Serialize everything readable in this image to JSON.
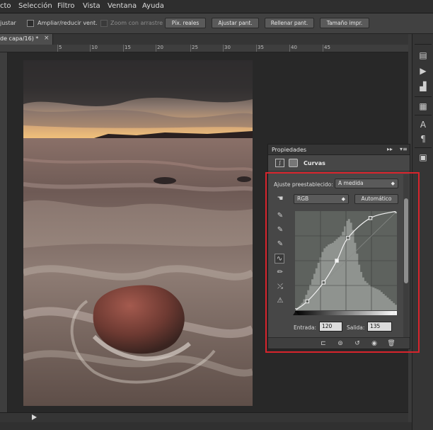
{
  "menubar": {
    "items": [
      "cto",
      "Selección",
      "Filtro",
      "Vista",
      "Ventana",
      "Ayuda"
    ]
  },
  "options_bar": {
    "left_text": "justar",
    "resize_windows_label": "Ampliar/reducir vent.",
    "scrubby_zoom_label": "Zoom con arrastre",
    "actual_pixels_btn": "Píx. reales",
    "fit_screen_btn": "Ajustar pant.",
    "fill_screen_btn": "Rellenar pant.",
    "print_size_btn": "Tamaño impr."
  },
  "document": {
    "tab_label": "de capa/16) *",
    "close_glyph": "×"
  },
  "ruler": {
    "ticks": [
      "5",
      "10",
      "15",
      "20",
      "25",
      "30",
      "35",
      "40",
      "45"
    ]
  },
  "properties_panel": {
    "title": "Propiedades",
    "adjustment_name": "Curvas",
    "preset_label": "Ajuste preestablecido:",
    "preset_value": "A medida",
    "channel_value": "RGB",
    "auto_button": "Automático",
    "input_label": "Entrada:",
    "input_value": "120",
    "output_label": "Salida:",
    "output_value": "135",
    "curve_points": [
      [
        0,
        0
      ],
      [
        0.12,
        0.09
      ],
      [
        0.28,
        0.28
      ],
      [
        0.41,
        0.5
      ],
      [
        0.52,
        0.73
      ],
      [
        0.74,
        0.93
      ],
      [
        1,
        1
      ]
    ],
    "histogram": [
      0.02,
      0.03,
      0.05,
      0.08,
      0.12,
      0.17,
      0.22,
      0.28,
      0.34,
      0.4,
      0.46,
      0.52,
      0.58,
      0.64,
      0.68,
      0.7,
      0.72,
      0.73,
      0.74,
      0.76,
      0.78,
      0.8,
      0.82,
      0.86,
      0.92,
      0.98,
      1.0,
      0.96,
      0.88,
      0.74,
      0.62,
      0.5,
      0.42,
      0.36,
      0.32,
      0.3,
      0.28,
      0.26,
      0.25,
      0.24,
      0.23,
      0.22,
      0.2,
      0.18,
      0.16,
      0.14,
      0.12,
      0.1,
      0.08,
      0.06
    ],
    "colors": {
      "highlight_box": "#d8242c"
    }
  }
}
